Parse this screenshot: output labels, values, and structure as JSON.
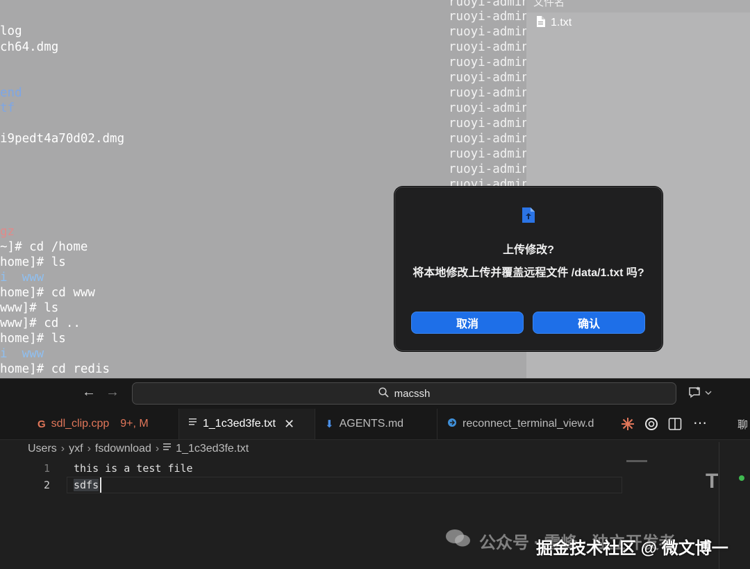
{
  "terminal": {
    "left_lines": [
      {
        "text": "log",
        "color": "white"
      },
      {
        "text": "ch64.dmg",
        "color": "white"
      },
      {
        "text": "end",
        "color": "blue"
      },
      {
        "text": "tf",
        "color": "blue"
      },
      {
        "text": "i9pedt4a70d02.dmg",
        "color": "white"
      },
      {
        "text": "gz",
        "color": "red"
      },
      {
        "text": "~]# cd /home",
        "color": "white"
      },
      {
        "text": "home]# ls",
        "color": "white"
      },
      {
        "text": "i  www",
        "color": "cyan"
      },
      {
        "text": "home]# cd www",
        "color": "white"
      },
      {
        "text": "www]# ls",
        "color": "white"
      },
      {
        "text": "www]# cd ..",
        "color": "white"
      },
      {
        "text": "home]# ls",
        "color": "white"
      },
      {
        "text": "i  www",
        "color": "cyan"
      },
      {
        "text": "home]# cd redis",
        "color": "white"
      }
    ],
    "right_lines": [
      "ruoyi-admin",
      "ruoyi-admin",
      "ruoyi-admin",
      "ruoyi-admin",
      "ruoyi-admin",
      "ruoyi-admin",
      "ruoyi-admin",
      "ruoyi-admin",
      "ruoyi-admin",
      "ruoyi-admin",
      "ruoyi-admin",
      "ruoyi-admin",
      "ruoyi-admin"
    ]
  },
  "file_panel": {
    "header": "文件名",
    "items": [
      "1.txt"
    ]
  },
  "dialog": {
    "icon": "file-upload-icon",
    "title": "上传修改?",
    "message": "将本地修改上传并覆盖远程文件 /data/1.txt 吗?",
    "cancel_label": "取消",
    "confirm_label": "确认",
    "accent": "#1e6fe8"
  },
  "editor": {
    "search_text": "macssh",
    "tabs": [
      {
        "label": "sdl_clip.cpp",
        "badge": "9+, M",
        "icon": "cpp-file-icon"
      },
      {
        "label": "1_1c3ed3fe.txt",
        "icon": "text-file-icon",
        "active": true
      },
      {
        "label": "AGENTS.md",
        "icon": "markdown-icon"
      },
      {
        "label": "reconnect_terminal_view.d",
        "icon": "dart-file-icon"
      }
    ],
    "right_panel_label": "聊",
    "breadcrumb": [
      "Users",
      "yxf",
      "fsdownload",
      "1_1c3ed3fe.txt"
    ],
    "lines": [
      {
        "num": "1",
        "text": "this is a test file"
      },
      {
        "num": "2",
        "text": "sdfs"
      }
    ],
    "minimap_letter": "T"
  },
  "watermarks": {
    "wechat": "公众号 · 雪峰 · 独立开发者",
    "juejin": "掘金技术社区 @ 微文博一"
  }
}
